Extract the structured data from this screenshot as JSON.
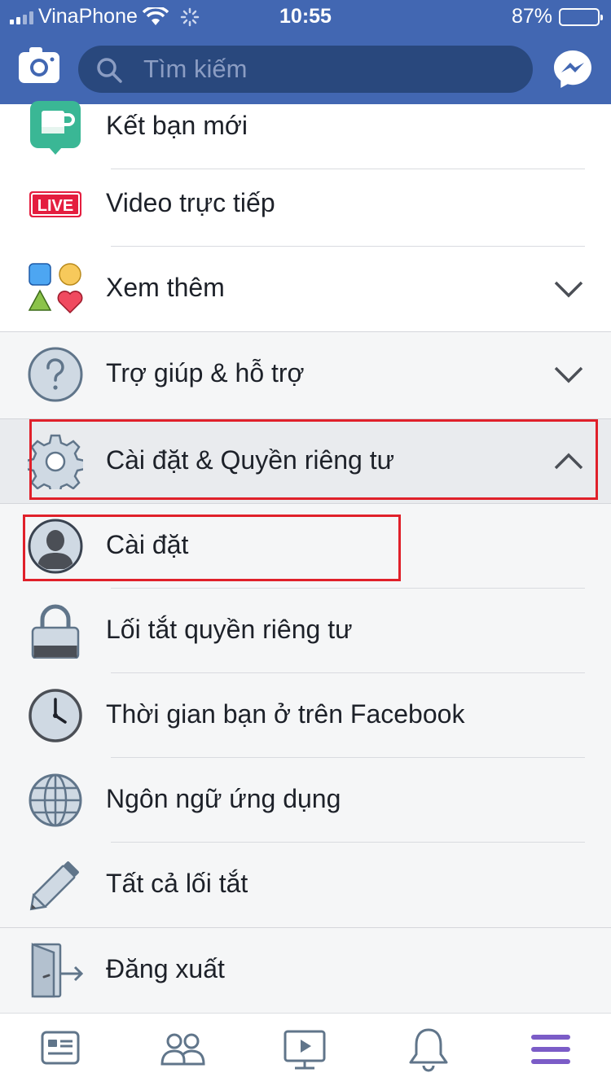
{
  "status": {
    "carrier": "VinaPhone",
    "time": "10:55",
    "battery": "87%",
    "battery_level": 0.87
  },
  "header": {
    "search_placeholder": "Tìm kiếm"
  },
  "menu": {
    "ket_ban_moi": "Kết bạn mới",
    "video": "Video trực tiếp",
    "live_badge": "LIVE",
    "xem_them": "Xem thêm",
    "tro_giup": "Trợ giúp & hỗ trợ",
    "cai_dat_quyen": "Cài đặt & Quyền riêng tư",
    "cai_dat": "Cài đặt",
    "loi_tat": "Lối tắt quyền riêng tư",
    "thoi_gian": "Thời gian bạn ở trên Facebook",
    "ngon_ngu": "Ngôn ngữ ứng dụng",
    "tat_ca": "Tất cả lối tắt",
    "dang_xuat": "Đăng xuất"
  },
  "colors": {
    "brand": "#4267b2",
    "search": "#29487d",
    "highlight": "#e0202a",
    "active_tab": "#7b5cc7"
  }
}
